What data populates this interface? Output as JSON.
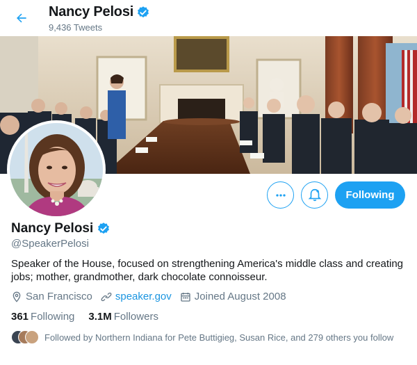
{
  "header": {
    "name": "Nancy Pelosi",
    "tweet_count": "9,436 Tweets"
  },
  "profile": {
    "name": "Nancy Pelosi",
    "handle": "@SpeakerPelosi",
    "bio": "Speaker of the House, focused on strengthening America's middle class and creating jobs; mother, grandmother, dark chocolate connoisseur.",
    "location": "San Francisco",
    "website": "speaker.gov",
    "joined": "Joined August 2008",
    "following_count": "361",
    "following_label": "Following",
    "followers_count": "3.1M",
    "followers_label": "Followers",
    "followed_by": "Followed by Northern Indiana for Pete Buttigieg, Susan Rice, and 279 others you follow"
  },
  "actions": {
    "follow_label": "Following"
  },
  "colors": {
    "accent": "#1da1f2",
    "link": "#1b95e0",
    "secondary_text": "#657786",
    "verified": "#1da1f2"
  },
  "icons": [
    "back-arrow-icon",
    "verified-badge-icon",
    "more-icon",
    "notification-bell-icon",
    "location-pin-icon",
    "link-icon",
    "calendar-icon"
  ]
}
